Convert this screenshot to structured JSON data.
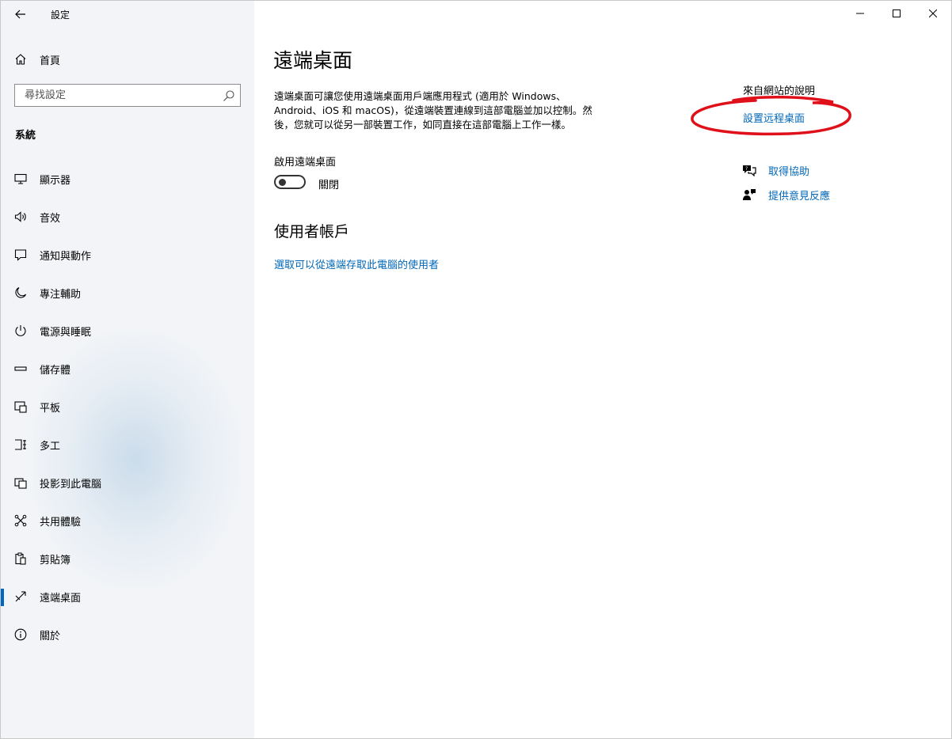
{
  "app": {
    "title": "設定"
  },
  "sidebar": {
    "home_label": "首頁",
    "search_placeholder": "尋找設定",
    "section_title": "系統",
    "items": [
      {
        "label": "顯示器",
        "icon": "monitor-icon"
      },
      {
        "label": "音效",
        "icon": "speaker-icon"
      },
      {
        "label": "通知與動作",
        "icon": "message-icon"
      },
      {
        "label": "專注輔助",
        "icon": "moon-icon"
      },
      {
        "label": "電源與睡眠",
        "icon": "power-icon"
      },
      {
        "label": "儲存體",
        "icon": "storage-icon"
      },
      {
        "label": "平板",
        "icon": "tablet-icon"
      },
      {
        "label": "多工",
        "icon": "multitask-icon"
      },
      {
        "label": "投影到此電腦",
        "icon": "project-icon"
      },
      {
        "label": "共用體驗",
        "icon": "share-icon"
      },
      {
        "label": "剪貼簿",
        "icon": "clipboard-icon"
      },
      {
        "label": "遠端桌面",
        "icon": "remote-icon",
        "active": true
      },
      {
        "label": "關於",
        "icon": "info-icon"
      }
    ]
  },
  "main": {
    "title": "遠端桌面",
    "description_line1": "遠端桌面可讓您使用遠端桌面用戶端應用程式 (適用於 Windows、",
    "description_line2": "Android、iOS 和 macOS)，從遠端裝置連線到這部電腦並加以控制。然",
    "description_line3": "後，您就可以從另一部裝置工作，如同直接在這部電腦上工作一樣。",
    "toggle_label": "啟用遠端桌面",
    "toggle_state": "關閉",
    "toggle_on": false,
    "user_accounts_title": "使用者帳戶",
    "user_accounts_link": "選取可以從遠端存取此電腦的使用者"
  },
  "help": {
    "title": "來自網站的說明",
    "setup_link": "設置远程桌面",
    "get_help": "取得協助",
    "feedback": "提供意見反應"
  },
  "colors": {
    "accent": "#0067b8",
    "annotation": "#e0101a"
  }
}
